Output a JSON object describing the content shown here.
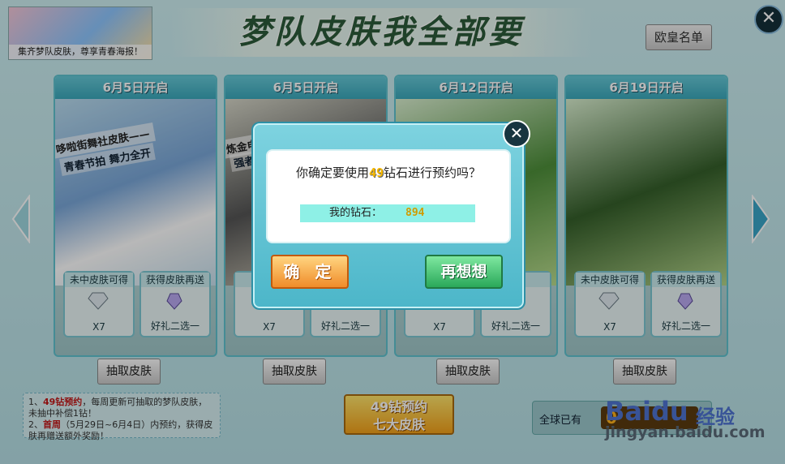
{
  "banner": {
    "text": "集齐梦队皮肤，尊享青春海报！"
  },
  "title": "梦队皮肤我全部要",
  "rank_button": "欧皇名单",
  "cards": [
    {
      "date": "6月5日开启",
      "tag": "哆啦街舞社皮肤——",
      "sub": "青春节拍 舞力全开",
      "rew_a_label": "未中皮肤可得",
      "rew_a_val": "X7",
      "rew_b_label": "获得皮肤再送",
      "rew_b_val": "好礼二选一",
      "draw": "抽取皮肤"
    },
    {
      "date": "6月5日开启",
      "tag": "炼金电竞社皮肤——",
      "sub": "强者竞…",
      "rew_a_label": "未中",
      "rew_a_val": "X7",
      "rew_b_label": "",
      "rew_b_val": "好礼二选一",
      "draw": "抽取皮肤"
    },
    {
      "date": "6月12日开启",
      "tag": "",
      "sub": "",
      "rew_a_label": "",
      "rew_a_val": "X7",
      "rew_b_label": "再送",
      "rew_b_val": "好礼二选一",
      "draw": "抽取皮肤"
    },
    {
      "date": "6月19日开启",
      "tag": "",
      "sub": "",
      "rew_a_label": "未中皮肤可得",
      "rew_a_val": "X7",
      "rew_b_label": "获得皮肤再送",
      "rew_b_val": "好礼二选一",
      "draw": "抽取皮肤"
    }
  ],
  "notes": {
    "line1_prefix": "1、",
    "line1_red": "49钻预约",
    "line1_rest": "，每周更新可抽取的梦队皮肤，未抽中补偿1钻！",
    "line2_prefix": "2、",
    "line2_red": "首周",
    "line2_rest": "（5月29日~6月4日）内预约，获得皮肤再赠送额外奖励！"
  },
  "reserve_button": {
    "line1": "49钻预约",
    "line2": "七大皮肤"
  },
  "global": {
    "label": "全球已有",
    "value": "0"
  },
  "watermark": {
    "main": "Baidu",
    "cn": "经验",
    "url": "jingyan.baidu.com"
  },
  "dialog": {
    "question_prefix": "你确定要使用",
    "question_num": "49",
    "question_suffix": "钻石进行预约吗？",
    "balance_label": "我的钻石：",
    "balance_value": "894",
    "confirm": "确 定",
    "rethink": "再想想",
    "close": "✕"
  },
  "close_main": "✕"
}
